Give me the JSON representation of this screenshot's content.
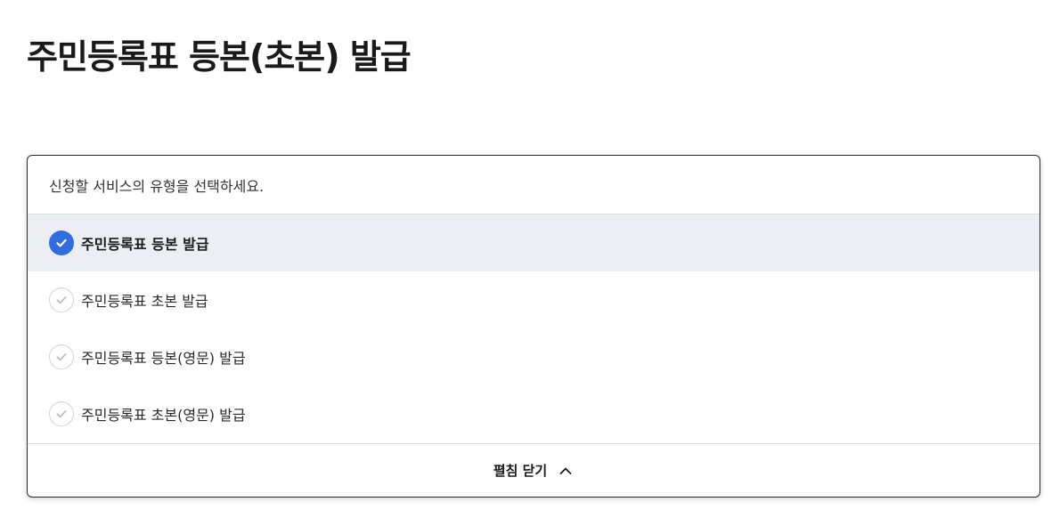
{
  "page": {
    "title": "주민등록표 등본(초본) 발급"
  },
  "service_select": {
    "prompt": "신청할 서비스의 유형을 선택하세요.",
    "options": [
      {
        "label": "주민등록표 등본 발급",
        "selected": true
      },
      {
        "label": "주민등록표 초본 발급",
        "selected": false
      },
      {
        "label": "주민등록표 등본(영문) 발급",
        "selected": false
      },
      {
        "label": "주민등록표 초본(영문) 발급",
        "selected": false
      }
    ],
    "collapse_label": "펼침 닫기",
    "icons": {
      "check": "check-circle-icon",
      "collapse": "chevron-up-icon"
    },
    "colors": {
      "accent": "#2f6de1",
      "selected_bg": "#eceef3"
    }
  }
}
